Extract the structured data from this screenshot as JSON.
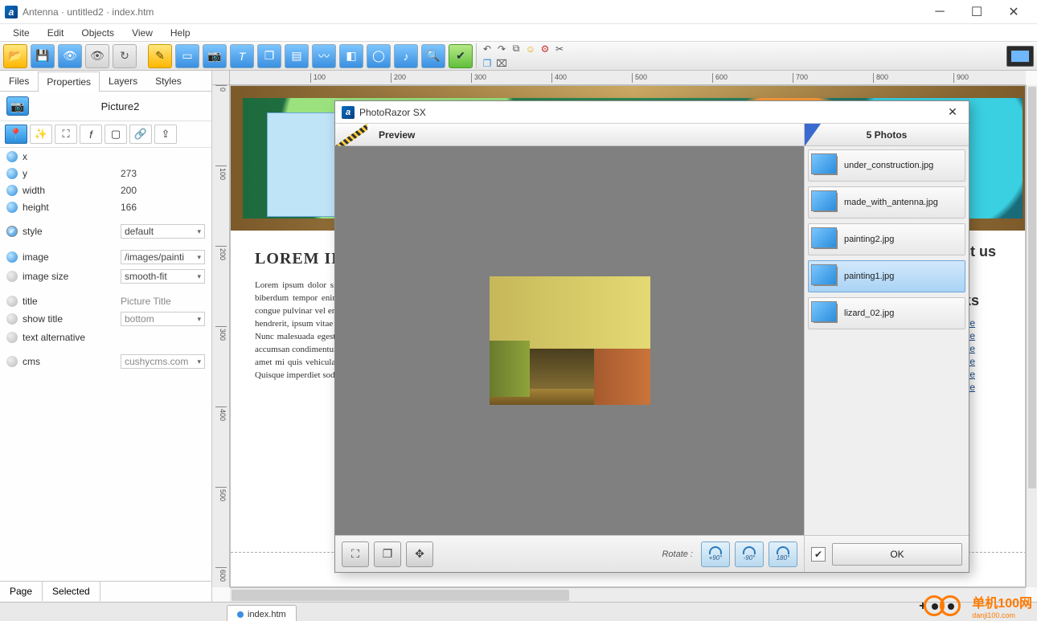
{
  "window": {
    "title": "Antenna · untitled2 · index.htm"
  },
  "menu": {
    "site": "Site",
    "edit": "Edit",
    "objects": "Objects",
    "view": "View",
    "help": "Help"
  },
  "leftpanel": {
    "tabs": {
      "files": "Files",
      "properties": "Properties",
      "layers": "Layers",
      "styles": "Styles"
    },
    "object_name": "Picture2",
    "props": {
      "x_label": "x",
      "x_val": "",
      "y_label": "y",
      "y_val": "273",
      "w_label": "width",
      "w_val": "200",
      "h_label": "height",
      "h_val": "166",
      "style_label": "style",
      "style_val": "default",
      "image_label": "image",
      "image_val": "/images/painti",
      "imgsize_label": "image size",
      "imgsize_val": "smooth-fit",
      "title_label": "title",
      "title_val": "Picture Title",
      "showtitle_label": "show title",
      "showtitle_val": "bottom",
      "alt_label": "text alternative",
      "alt_val": "",
      "cms_label": "cms",
      "cms_val": "cushycms.com"
    },
    "bottom": {
      "page": "Page",
      "selected": "Selected"
    }
  },
  "ruler": {
    "t100": "100",
    "t200": "200",
    "t300": "300",
    "t400": "400",
    "t500": "500",
    "t600": "600",
    "t700": "700",
    "t800": "800",
    "t900": "900",
    "v0": "0",
    "v100": "100",
    "v200": "200",
    "v300": "300",
    "v400": "400",
    "v500": "500",
    "v600": "600"
  },
  "pagebody": {
    "heading": "LOREM IPSUM",
    "para": "Lorem ipsum dolor sit amet, consectetuer adipiscing elit. Cras id ante ac auctor elit. Ut biberdum tempor enim, et sollicitudin molestie volutpat. Donec tempor turpis, in lacinia congue pulvinar vel erat. Sed molestie orci eu lectus tortor. In dapibus semper massa Mauris hendrerit, ipsum vitae commodo iaculis, dui ante pretium magna, et tempus felis nisi lorem. Nunc malesuada egestas felis tortor. Vestibulum in magna. Cras vehicula dolor nec sagittis accumsan condimentum lorem dolor. Quisque varius. Phasellus Etiam mauris. Vestibulum sit amet mi quis vehicula lacinia. Curabitur eu nonummy ante, vitae congue metus eget nibh. Quisque imperdiet sodales metus bibendum tempus. Phasellus lorem.",
    "contact": "act us",
    "links_h": "nks",
    "link": "Here"
  },
  "dialog": {
    "title": "PhotoRazor SX",
    "preview": "Preview",
    "photos_head": "5 Photos",
    "items": {
      "i0": "under_construction.jpg",
      "i1": "made_with_antenna.jpg",
      "i2": "painting2.jpg",
      "i3": "painting1.jpg",
      "i4": "lizard_02.jpg"
    },
    "rotate": "Rotate :",
    "r90p": "+90°",
    "r90m": "-90°",
    "r180": "180°",
    "ok": "OK"
  },
  "doctab": {
    "name": "index.htm"
  },
  "watermark": {
    "big": "单机100网",
    "small": "danji100.com"
  }
}
